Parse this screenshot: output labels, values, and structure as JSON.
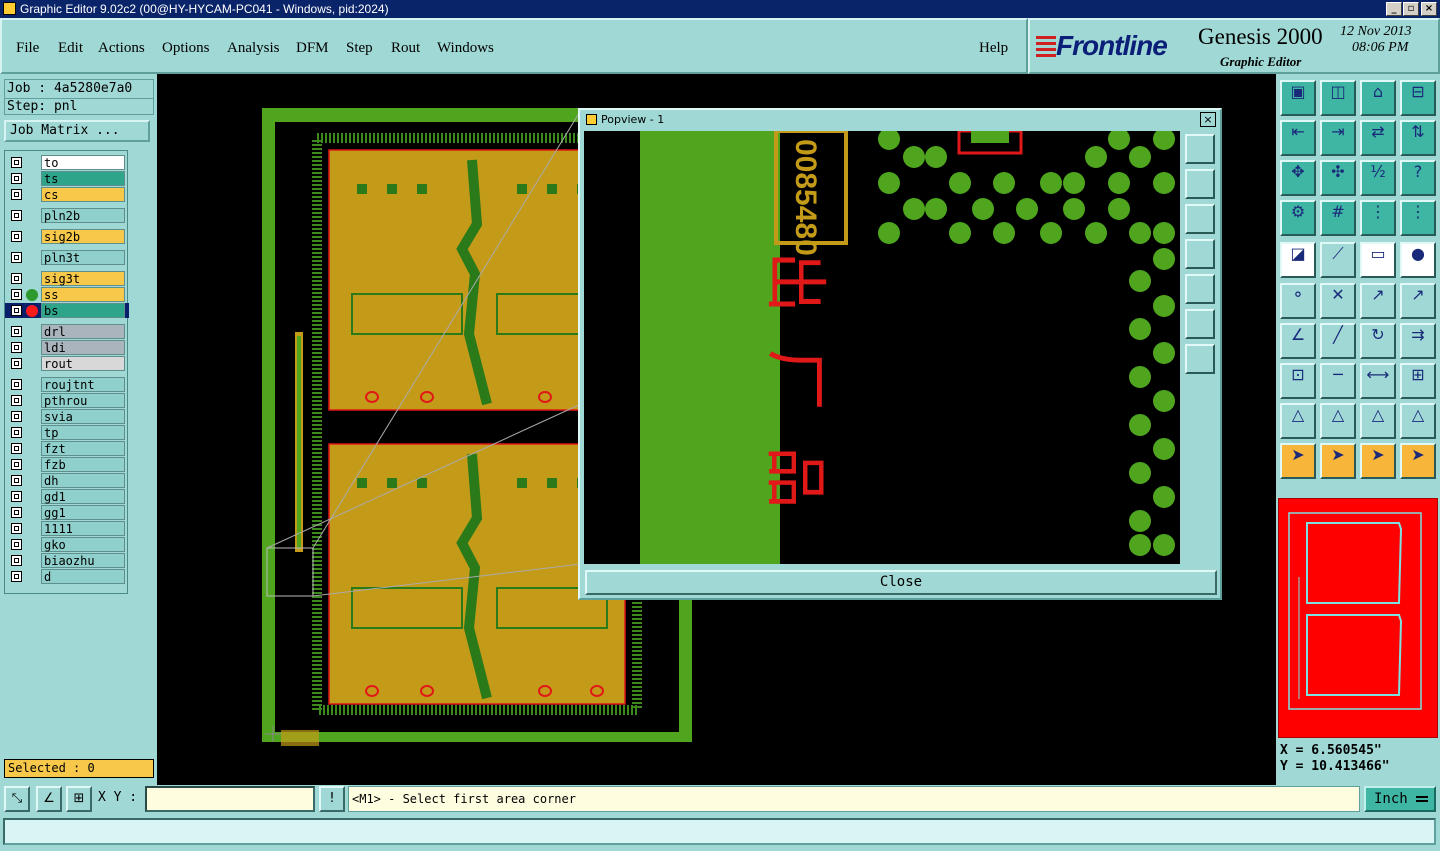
{
  "window": {
    "title": "Graphic Editor 9.02c2 (00@HY-HYCAM-PC041 - Windows, pid:2024)"
  },
  "menu": [
    "File",
    "Edit",
    "Actions",
    "Options",
    "Analysis",
    "DFM",
    "Step",
    "Rout",
    "Windows"
  ],
  "help": "Help",
  "brand": {
    "logo": "Frontline",
    "product": "Genesis 2000",
    "subtitle": "Graphic Editor",
    "date": "12 Nov 2013",
    "time": "08:06 PM"
  },
  "job": {
    "job_line": "Job : 4a5280e7a0",
    "step_line": "Step: pnl",
    "matrix_button": "Job Matrix ..."
  },
  "layers": [
    {
      "name": "to",
      "color": "#ffffff"
    },
    {
      "name": "ts",
      "color": "#2ea58a"
    },
    {
      "name": "cs",
      "color": "#f7c84a"
    },
    {
      "name": "pln2b",
      "color": "#8fd0cc"
    },
    {
      "name": "sig2b",
      "color": "#f7c84a"
    },
    {
      "name": "pln3t",
      "color": "#8fd0cc"
    },
    {
      "name": "sig3t",
      "color": "#f7c84a"
    },
    {
      "name": "ss",
      "color": "#f7c84a"
    },
    {
      "name": "bs",
      "color": "#2ea58a"
    },
    {
      "name": "drl",
      "color": "#a9b4bc"
    },
    {
      "name": "ldi",
      "color": "#a9b4bc"
    },
    {
      "name": "rout",
      "color": "#d8d8d8"
    },
    {
      "name": "roujtnt",
      "color": "#8fd0cc"
    },
    {
      "name": "pthrou",
      "color": "#8fd0cc"
    },
    {
      "name": "svia",
      "color": "#8fd0cc"
    },
    {
      "name": "tp",
      "color": "#8fd0cc"
    },
    {
      "name": "fzt",
      "color": "#8fd0cc"
    },
    {
      "name": "fzb",
      "color": "#8fd0cc"
    },
    {
      "name": "dh",
      "color": "#8fd0cc"
    },
    {
      "name": "gd1",
      "color": "#8fd0cc"
    },
    {
      "name": "gg1",
      "color": "#8fd0cc"
    },
    {
      "name": "1111",
      "color": "#8fd0cc"
    },
    {
      "name": "gko",
      "color": "#8fd0cc"
    },
    {
      "name": "biaozhu",
      "color": "#8fd0cc"
    },
    {
      "name": "d",
      "color": "#8fd0cc"
    }
  ],
  "selected": "Selected : 0",
  "xy_label": "X Y :",
  "xy_value": "",
  "message": "<M1> - Select first area corner",
  "units": "Inch",
  "popup": {
    "title": "Popview - 1",
    "close_button": "Close",
    "board_text": "0085480",
    "chinese_text": "出 厂 品"
  },
  "coords": {
    "x": "X =  6.560545\"",
    "y": "Y = 10.413466\""
  },
  "colors": {
    "panel": "#9fd8d4",
    "board_green": "#4fa61e",
    "copper": "#c49b18",
    "silk": "#e01818"
  }
}
